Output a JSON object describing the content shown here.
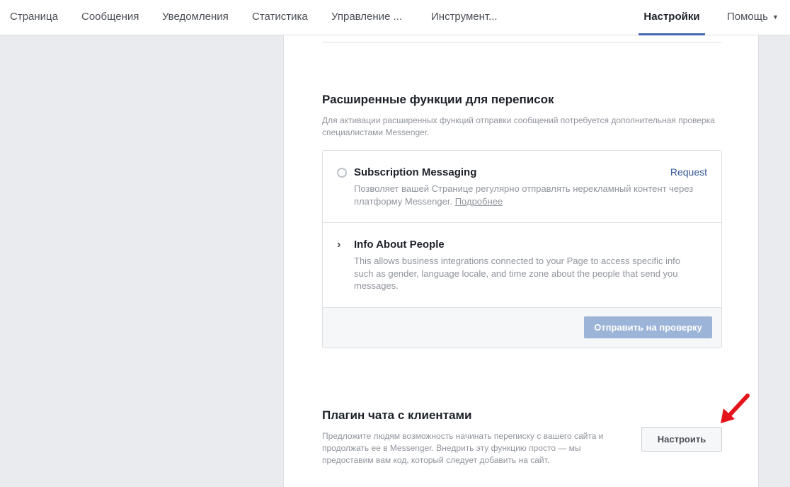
{
  "nav": {
    "items": [
      {
        "label": "Страница"
      },
      {
        "label": "Сообщения"
      },
      {
        "label": "Уведомления"
      },
      {
        "label": "Статистика"
      },
      {
        "label": "Управление ..."
      },
      {
        "label": "Инструмент..."
      }
    ],
    "active": "Настройки",
    "help": "Помощь",
    "help_caret": "▼"
  },
  "advanced": {
    "title": "Расширенные функции для переписок",
    "desc": "Для активации расширенных функций отправки сообщений потребуется дополнительная проверка специалистами Messenger.",
    "features": [
      {
        "title": "Subscription Messaging",
        "desc": "Позволяет вашей Странице регулярно отправлять нерекламный контент через платформу Messenger.",
        "link": "Подробнее",
        "action": "Request",
        "icon": "radio-icon"
      },
      {
        "title": "Info About People",
        "desc": "This allows business integrations connected to your Page to access specific info such as gender, language locale, and time zone about the people that send you messages.",
        "icon": "chevron-right-icon",
        "chevron": "›"
      }
    ],
    "submit": "Отправить на проверку"
  },
  "plugin": {
    "title": "Плагин чата с клиентами",
    "desc": "Предложите людям возможность начинать переписку с вашего сайта и продолжать ее в Messenger. Внедрить эту функцию просто — мы предоставим вам код, который следует добавить на сайт.",
    "button": "Настроить"
  },
  "colors": {
    "accent": "#4267b2",
    "link": "#365899",
    "annotation_arrow": "#e4141b"
  }
}
